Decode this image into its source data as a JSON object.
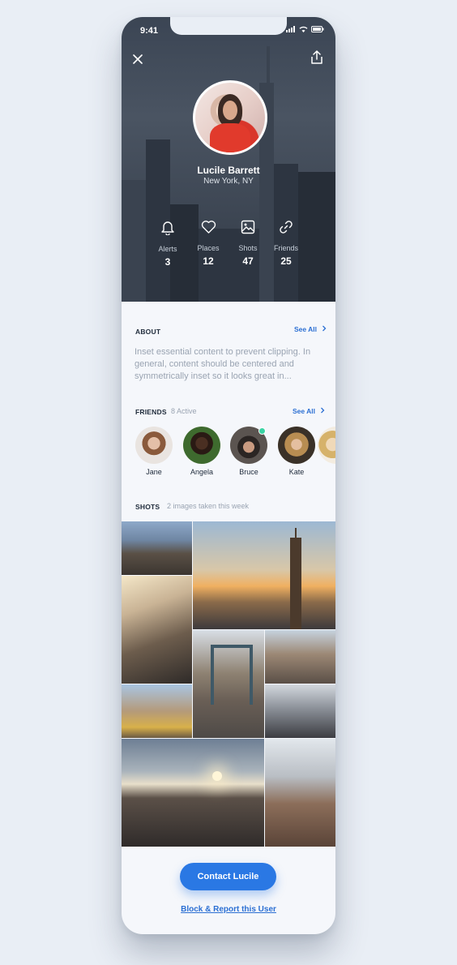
{
  "status_bar": {
    "time": "9:41"
  },
  "header": {
    "close_icon": "close-icon",
    "share_icon": "share-icon"
  },
  "profile": {
    "name": "Lucile Barrett",
    "location": "New York, NY"
  },
  "stats": [
    {
      "icon": "bell-icon",
      "label": "Alerts",
      "value": "3"
    },
    {
      "icon": "heart-icon",
      "label": "Places",
      "value": "12"
    },
    {
      "icon": "image-icon",
      "label": "Shots",
      "value": "47"
    },
    {
      "icon": "link-icon",
      "label": "Friends",
      "value": "25"
    }
  ],
  "about": {
    "title": "ABOUT",
    "see_all": "See All",
    "text": "Inset essential content to prevent clipping. In general, content should be centered and symmetrically inset so it looks great in..."
  },
  "friends": {
    "title": "FRIENDS",
    "subtitle": "8 Active",
    "see_all": "See All",
    "items": [
      {
        "name": "Jane",
        "active": false
      },
      {
        "name": "Angela",
        "active": false
      },
      {
        "name": "Bruce",
        "active": true
      },
      {
        "name": "Kate",
        "active": false
      }
    ]
  },
  "shots": {
    "title": "SHOTS",
    "subtitle": "2 images taken this week"
  },
  "actions": {
    "contact": "Contact Lucile",
    "report": "Block & Report this User"
  },
  "colors": {
    "accent": "#2a78e4",
    "active_dot": "#3ad3a4",
    "hero": "#3b4554"
  }
}
